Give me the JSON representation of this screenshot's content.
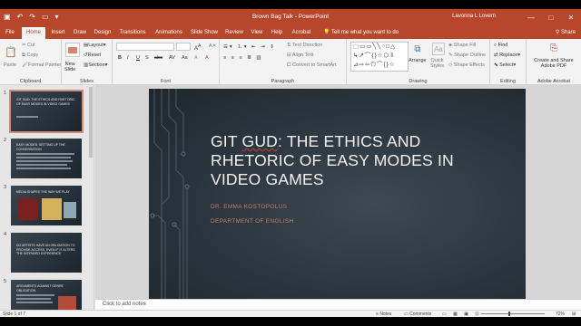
{
  "window": {
    "title": "Brown Bag Talk - PowerPoint",
    "user": "Lavonna L Lovern",
    "controls": [
      "—",
      "□",
      "✕"
    ]
  },
  "quick_access": {
    "save_icon": "save-icon",
    "undo_icon": "undo-icon",
    "redo_icon": "redo-icon",
    "present_icon": "present-icon",
    "customize_icon": "customize-icon"
  },
  "tabs": [
    "File",
    "Home",
    "Insert",
    "Draw",
    "Design",
    "Transitions",
    "Animations",
    "Slide Show",
    "Review",
    "View",
    "Help",
    "Acrobat"
  ],
  "active_tab": "Home",
  "tell_me": "Tell me what you want to do",
  "share": "Share",
  "ribbon": {
    "clipboard": {
      "label": "Clipboard",
      "paste": "Paste",
      "cut": "Cut",
      "copy": "Copy",
      "format_painter": "Format Painter"
    },
    "slides": {
      "label": "Slides",
      "new_slide_line1": "New",
      "new_slide_line2": "Slide",
      "layout": "Layout",
      "reset": "Reset",
      "section": "Section"
    },
    "font": {
      "label": "Font",
      "styles": [
        "B",
        "I",
        "U",
        "S",
        "abc",
        "AV",
        "Aa",
        "A",
        "A"
      ]
    },
    "paragraph": {
      "label": "Paragraph",
      "text_direction": "Text Direction",
      "align_text": "Align Text",
      "smartart": "Convert to SmartArt"
    },
    "drawing": {
      "label": "Drawing",
      "arrange": "Arrange",
      "quick_line1": "Quick",
      "quick_line2": "Styles",
      "shape_fill": "Shape Fill",
      "shape_outline": "Shape Outline",
      "shape_effects": "Shape Effects",
      "shapes_row1": "⬚▭▭╲╲○□△",
      "shapes_row2": "↳↗⌒{}☆⬡⇩",
      "shapes_row3": "⊿⇨⇦⬠⌒{}☆"
    },
    "editing": {
      "label": "Editing",
      "find": "Find",
      "replace": "Replace",
      "select": "Select"
    },
    "acrobat": {
      "label": "Adobe Acrobat",
      "line1": "Create and Share",
      "line2": "Adobe PDF"
    }
  },
  "thumbnails": [
    {
      "num": "1",
      "title": "Git Gud: The Ethics and Rhetoric of Easy Modes in Video Games"
    },
    {
      "num": "2",
      "title": "Easy Modes: Setting up the conversation"
    },
    {
      "num": "3",
      "title": "Media Shapes the Way we Play"
    },
    {
      "num": "4",
      "title": "Do artists have an obligation to provide access, even if it alters the intended experience"
    },
    {
      "num": "5",
      "title": "Arguments against Genre Obligation"
    }
  ],
  "slide": {
    "title_line1_pre": "GIT ",
    "title_line1_gud": "GUD",
    "title_line1_post": ": THE ETHICS AND",
    "title_line2": "RHETORIC OF EASY MODES IN",
    "title_line3": "VIDEO GAMES",
    "author": "DR. EMMA KOSTOPOLUS",
    "department": "DEPARTMENT OF ENGLISH"
  },
  "notes_placeholder": "Click to add notes",
  "status": {
    "slide_of": "Slide 1 of 7",
    "notes": "Notes",
    "comments": "Comments",
    "zoom": "72%"
  },
  "colors": {
    "accent": "#b7472a",
    "slide_bg": "#2b353d",
    "subtitle": "#c47c66"
  }
}
